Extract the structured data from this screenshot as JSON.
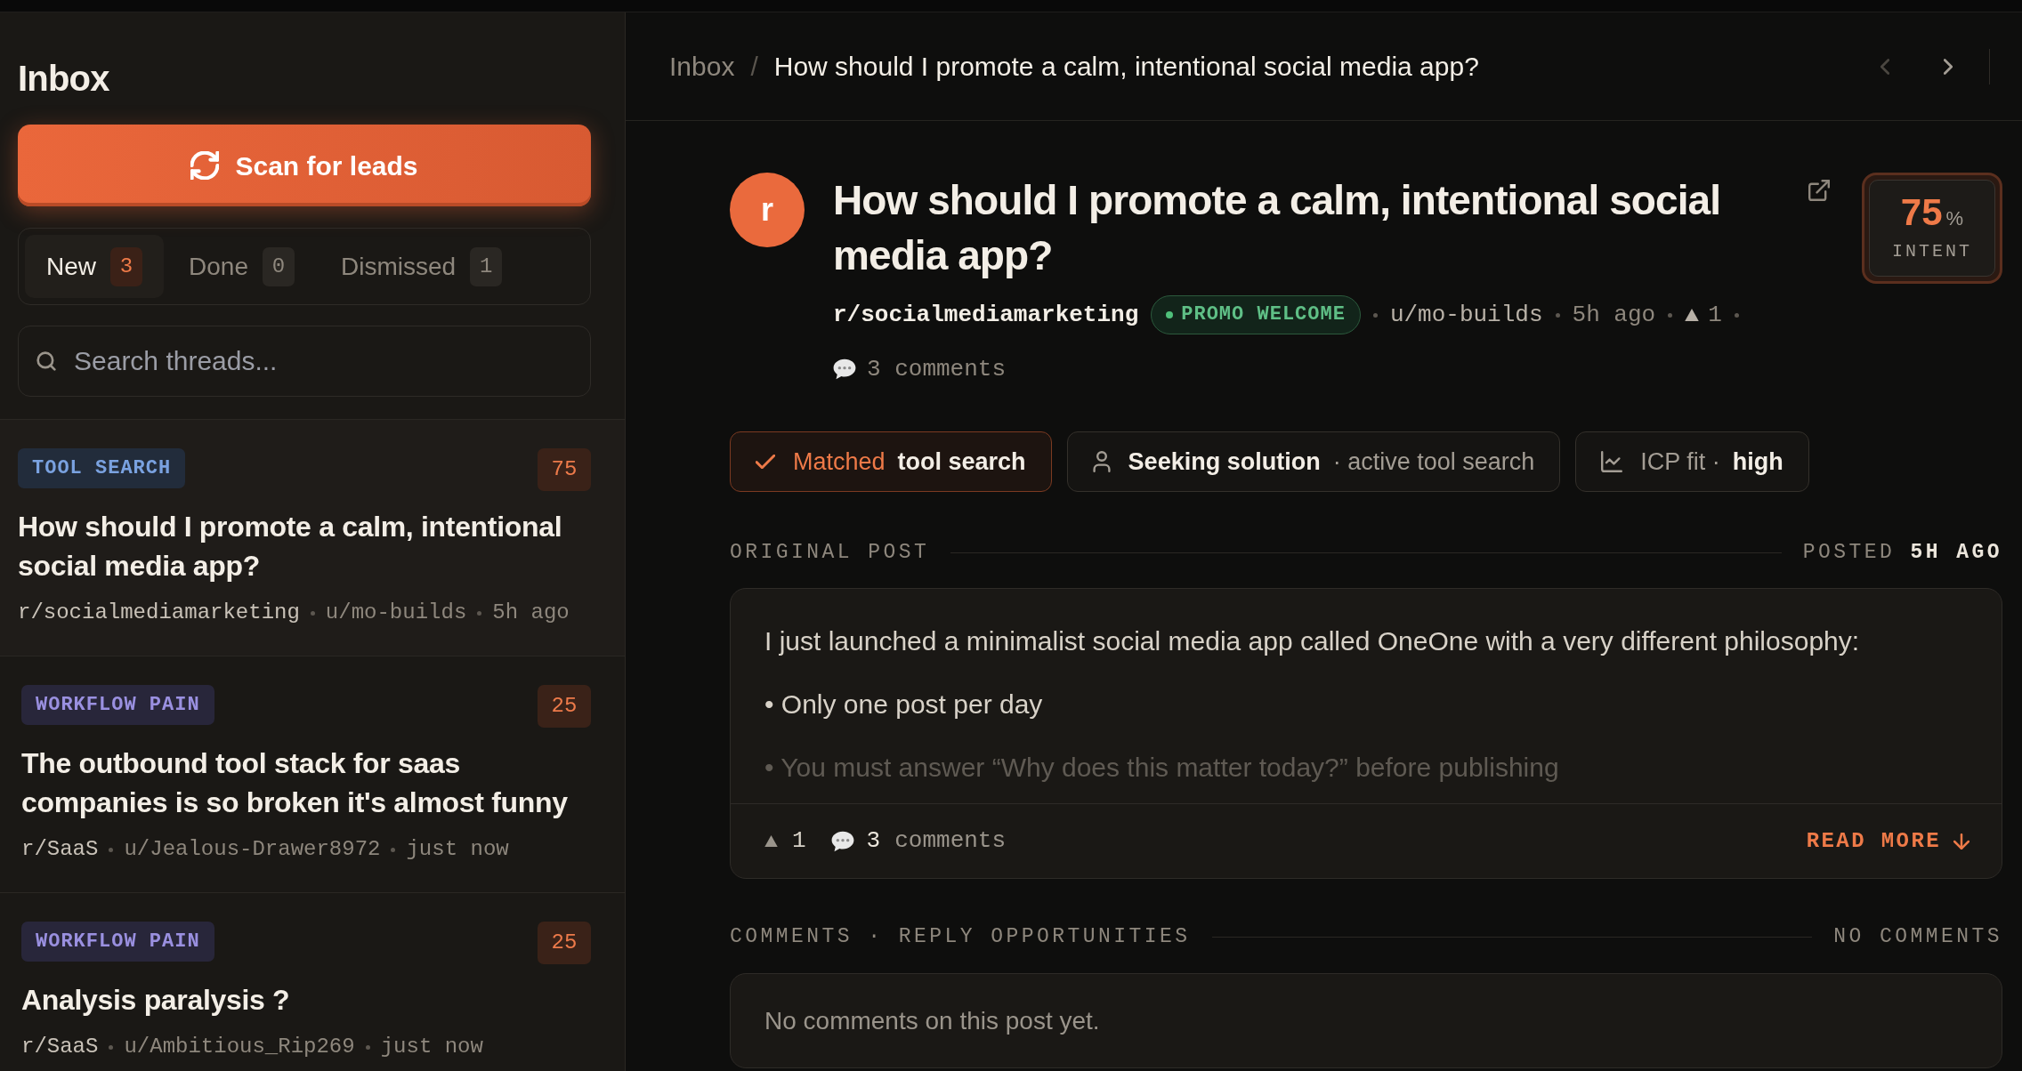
{
  "sidebar": {
    "title": "Inbox",
    "scan_button": {
      "label": "Scan for leads"
    },
    "tabs": [
      {
        "label": "New",
        "count": "3",
        "selected": true
      },
      {
        "label": "Done",
        "count": "0",
        "selected": false
      },
      {
        "label": "Dismissed",
        "count": "1",
        "selected": false
      }
    ],
    "search": {
      "placeholder": "Search threads..."
    },
    "threads": [
      {
        "tag": {
          "label": "TOOL SEARCH",
          "kind": "tool_search"
        },
        "score": "75",
        "title": "How should I promote a calm, intentional social media app?",
        "subreddit": "r/socialmediamarketing",
        "author": "u/mo-builds",
        "time": "5h ago",
        "selected": true
      },
      {
        "tag": {
          "label": "WORKFLOW PAIN",
          "kind": "workflow_pain"
        },
        "score": "25",
        "title": "The outbound tool stack for saas companies is so broken it's almost funny",
        "subreddit": "r/SaaS",
        "author": "u/Jealous-Drawer8972",
        "time": "just now",
        "selected": false
      },
      {
        "tag": {
          "label": "WORKFLOW PAIN",
          "kind": "workflow_pain"
        },
        "score": "25",
        "title": "Analysis paralysis ?",
        "subreddit": "r/SaaS",
        "author": "u/Ambitious_Rip269",
        "time": "just now",
        "selected": false
      }
    ]
  },
  "header": {
    "breadcrumb": {
      "parent": "Inbox",
      "separator": "/",
      "current": "How should I promote a calm, intentional social media app?"
    },
    "nav": [
      {
        "kind": "prev",
        "disabled": true
      },
      {
        "kind": "next",
        "disabled": false
      }
    ]
  },
  "post": {
    "avatar": "r",
    "title": "How should I promote a calm, intentional social media app?",
    "subreddit": "r/socialmediamarketing",
    "badge": "PROMO WELCOME",
    "author": "u/mo-builds",
    "time": "5h ago",
    "upvotes": "1",
    "comments": "3 comments",
    "intent": {
      "value": "75",
      "unit": "%",
      "label": "INTENT"
    }
  },
  "chips": [
    {
      "kind": "match",
      "label": "Matched",
      "value": "tool search"
    },
    {
      "kind": "signal",
      "label": "Seeking solution",
      "value": "· active tool search"
    },
    {
      "kind": "fit",
      "label": "ICP fit ·",
      "value": "high"
    }
  ],
  "original_post": {
    "heading": "ORIGINAL POST",
    "posted": "POSTED **5H AGO**",
    "paragraphs": [
      "I just launched a minimalist social media app called OneOne with a very different philosophy:",
      "• Only one post per day",
      "• You must answer “Why does this matter today?” before publishing"
    ],
    "expanded": false,
    "upvotes": "1",
    "comment_count": "3",
    "comment_label": "comments",
    "read_more": "READ MORE"
  },
  "comments": {
    "heading": "COMMENTS · REPLY OPPORTUNITIES",
    "count": "NO COMMENTS",
    "empty_text": "No comments on this post yet."
  }
}
